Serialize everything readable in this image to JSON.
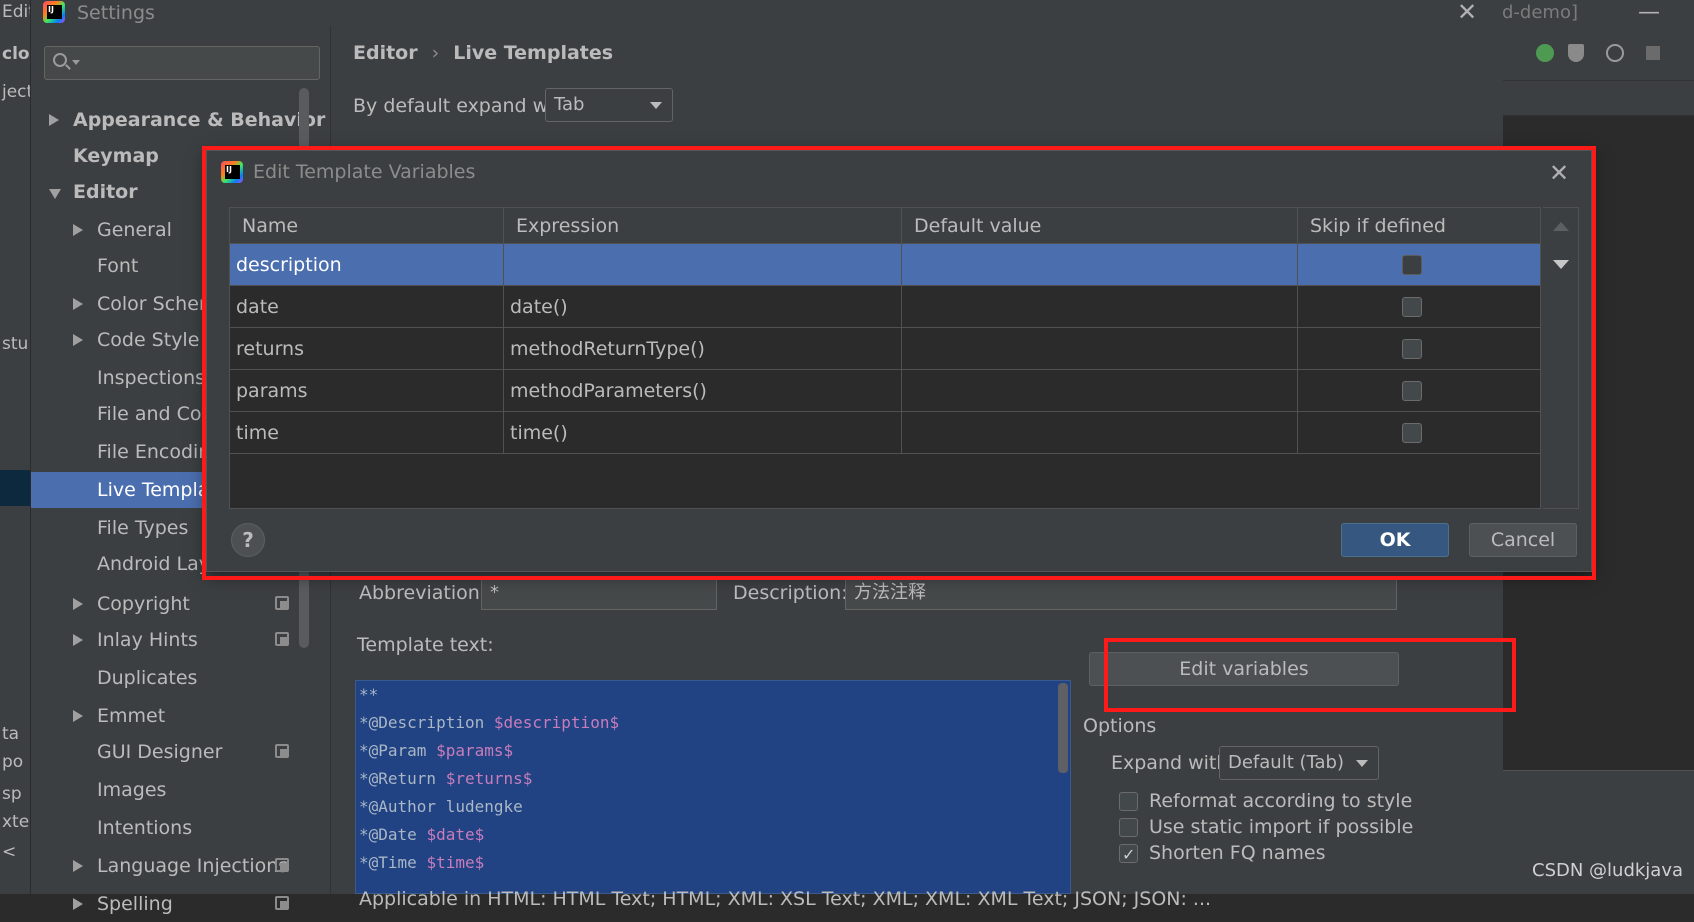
{
  "background": {
    "left_fragments": [
      "Edit",
      "clou",
      "ject",
      "stu",
      "ta",
      "po",
      "sp",
      "xter",
      "<"
    ],
    "right_fragment": "d-demo]"
  },
  "settings": {
    "title": "Settings",
    "search": {
      "placeholder": ""
    },
    "sidebar": {
      "items": [
        {
          "label": "Appearance & Behavior",
          "arrow": "right",
          "bold": true
        },
        {
          "label": "Keymap",
          "arrow": "none",
          "bold": true
        },
        {
          "label": "Editor",
          "arrow": "down",
          "bold": true
        },
        {
          "label": "General",
          "arrow": "right"
        },
        {
          "label": "Font",
          "arrow": "none"
        },
        {
          "label": "Color Scheme",
          "arrow": "right"
        },
        {
          "label": "Code Style",
          "arrow": "right"
        },
        {
          "label": "Inspections",
          "arrow": "none"
        },
        {
          "label": "File and Code Templates",
          "arrow": "none"
        },
        {
          "label": "File Encodings",
          "arrow": "none"
        },
        {
          "label": "Live Templates",
          "arrow": "none",
          "selected": true
        },
        {
          "label": "File Types",
          "arrow": "none"
        },
        {
          "label": "Android Layout Editor",
          "arrow": "none"
        },
        {
          "label": "Copyright",
          "arrow": "right",
          "project": true
        },
        {
          "label": "Inlay Hints",
          "arrow": "right",
          "project": true
        },
        {
          "label": "Duplicates",
          "arrow": "none"
        },
        {
          "label": "Emmet",
          "arrow": "right"
        },
        {
          "label": "GUI Designer",
          "arrow": "none",
          "project": true
        },
        {
          "label": "Images",
          "arrow": "none"
        },
        {
          "label": "Intentions",
          "arrow": "none"
        },
        {
          "label": "Language Injections",
          "arrow": "right",
          "project": true
        },
        {
          "label": "Spelling",
          "arrow": "right",
          "project": true
        }
      ]
    },
    "breadcrumb": {
      "parent": "Editor",
      "current": "Live Templates"
    },
    "expand_with": {
      "label": "By default expand with",
      "value": "Tab"
    },
    "abbreviation": {
      "label": "Abbreviation:",
      "value": "*"
    },
    "description": {
      "label": "Description:",
      "value": "方法注释"
    },
    "template_text": {
      "label": "Template text:",
      "lines": [
        {
          "text": "**",
          "var": ""
        },
        {
          "text": "*@Description ",
          "var": "$description$"
        },
        {
          "text": "*@Param ",
          "var": "$params$"
        },
        {
          "text": "*@Return ",
          "var": "$returns$"
        },
        {
          "text": "*@Author ludengke",
          "var": ""
        },
        {
          "text": "*@Date ",
          "var": "$date$"
        },
        {
          "text": "*@Time ",
          "var": "$time$"
        }
      ]
    },
    "edit_variables_label": "Edit variables",
    "options": {
      "title": "Options",
      "expand_with_label": "Expand with",
      "expand_with_value": "Default (Tab)",
      "checkboxes": [
        {
          "label": "Reformat according to style",
          "checked": false
        },
        {
          "label": "Use static import if possible",
          "checked": false
        },
        {
          "label": "Shorten FQ names",
          "checked": true
        }
      ]
    },
    "applicable": "Applicable in HTML: HTML Text; HTML; XML: XSL Text; XML; XML: XML Text; JSON; JSON: ..."
  },
  "dialog": {
    "title": "Edit Template Variables",
    "columns": [
      "Name",
      "Expression",
      "Default value",
      "Skip if defined"
    ],
    "rows": [
      {
        "name": "description",
        "expression": "",
        "default_value": "",
        "skip": false,
        "selected": true
      },
      {
        "name": "date",
        "expression": "date()",
        "default_value": "",
        "skip": false
      },
      {
        "name": "returns",
        "expression": "methodReturnType()",
        "default_value": "",
        "skip": false
      },
      {
        "name": "params",
        "expression": "methodParameters()",
        "default_value": "",
        "skip": false
      },
      {
        "name": "time",
        "expression": "time()",
        "default_value": "",
        "skip": false
      }
    ],
    "ok_label": "OK",
    "cancel_label": "Cancel",
    "help_label": "?"
  },
  "annotation_color": "#ff1a1a",
  "watermark": "CSDN @ludkjava"
}
